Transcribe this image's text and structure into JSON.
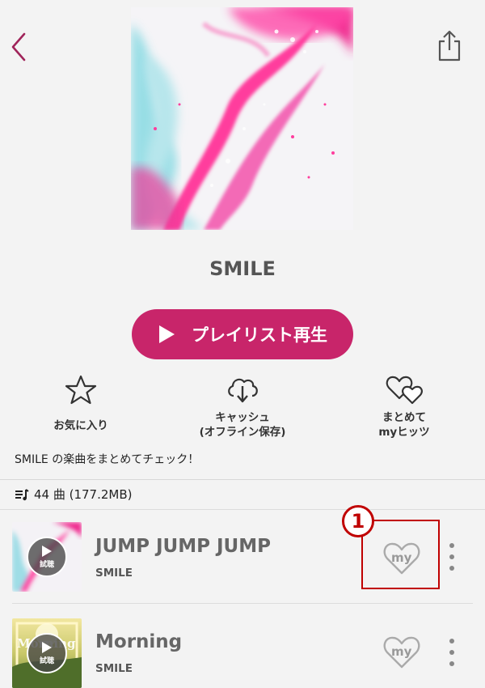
{
  "playlist": {
    "title": "SMILE",
    "play_label": "プレイリスト再生",
    "description": "SMILE の楽曲をまとめてチェック！",
    "count_label": "44 曲 (177.2MB)"
  },
  "actions": [
    {
      "icon": "star-icon",
      "lines": [
        "お気に入り"
      ]
    },
    {
      "icon": "cloud-download-icon",
      "lines": [
        "キャッシュ",
        "(オフライン保存)"
      ]
    },
    {
      "icon": "hearts-icon",
      "lines": [
        "まとめて",
        "myヒッツ"
      ]
    }
  ],
  "songs": [
    {
      "title": "JUMP JUMP JUMP",
      "artist": "SMILE",
      "preview_label": "試聴",
      "my_label": "my"
    },
    {
      "title": "Morning",
      "artist": "SMILE",
      "preview_label": "試聴",
      "my_label": "my",
      "thumb_text": "Morning"
    }
  ],
  "annotation": {
    "number": "1"
  },
  "colors": {
    "accent": "#c8256a",
    "highlight": "#c00000",
    "background": "#f3f3f3"
  }
}
